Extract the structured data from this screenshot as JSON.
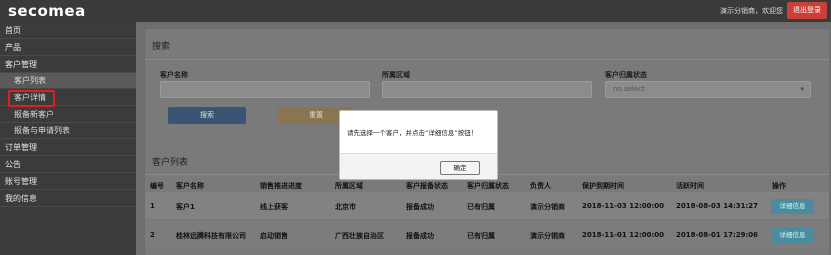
{
  "header": {
    "logo": "secomea",
    "user_greeting": "演示分销商，欢迎您",
    "logout_label": "退出登录"
  },
  "sidebar": {
    "items": [
      {
        "label": "首页"
      },
      {
        "label": "产品"
      },
      {
        "label": "客户管理"
      },
      {
        "label": "客户列表"
      },
      {
        "label": "客户详情"
      },
      {
        "label": "报备新客户"
      },
      {
        "label": "报备与申请列表"
      },
      {
        "label": "订单管理"
      },
      {
        "label": "公告"
      },
      {
        "label": "账号管理"
      },
      {
        "label": "我的信息"
      }
    ]
  },
  "search": {
    "title": "搜索",
    "customer_name_label": "客户名称",
    "region_label": "所属区域",
    "ownership_label": "客户归属状态",
    "ownership_placeholder": "no select",
    "search_button": "搜索",
    "reset_button": "重置"
  },
  "customer_list": {
    "title": "客户列表",
    "columns": [
      "编号",
      "客户名称",
      "销售推进进度",
      "所属区域",
      "客户报备状态",
      "客户归属状态",
      "负责人",
      "保护到期时间",
      "活跃时间",
      "操作"
    ],
    "rows": [
      [
        "1",
        "客户1",
        "线上获客",
        "北京市",
        "报备成功",
        "已有归属",
        "演示分销商",
        "2018-11-03 12:00:00",
        "2018-08-03 14:31:27",
        "详细信息"
      ],
      [
        "2",
        "桂林远腾科技有限公司",
        "启动销售",
        "广西壮族自治区",
        "报备成功",
        "已有归属",
        "演示分销商",
        "2018-11-01 12:00:00",
        "2018-08-01 17:29:06",
        "详细信息"
      ]
    ]
  },
  "modal": {
    "message": "请先选择一个客户，并点击“详细信息”按钮！",
    "ok_label": "确定"
  }
}
